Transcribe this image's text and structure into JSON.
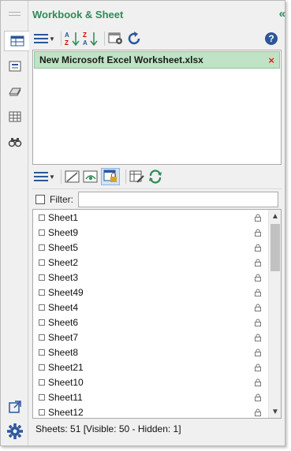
{
  "header": {
    "title": "Workbook & Sheet",
    "collapse_glyph": "«"
  },
  "sidebar": {
    "tabs": [
      {
        "icon": "workbook-sheet-icon",
        "active": true
      },
      {
        "icon": "autotext-icon",
        "active": false
      },
      {
        "icon": "name-manager-icon",
        "active": false
      },
      {
        "icon": "column-list-icon",
        "active": false
      },
      {
        "icon": "find-replace-icon",
        "active": false
      }
    ],
    "bottom": [
      {
        "icon": "undock-icon"
      },
      {
        "icon": "settings-gear-icon"
      }
    ]
  },
  "toolbar1": {
    "items": [
      "list-view-icon",
      "sort-ascending-icon",
      "sort-descending-icon",
      "settings-icon",
      "refresh-icon",
      "help-icon"
    ],
    "help_glyph": "?"
  },
  "workbooks": [
    {
      "name": "New Microsoft Excel Worksheet.xlsx",
      "close_glyph": "×"
    }
  ],
  "toolbar2": {
    "items": [
      "list-view-icon",
      "hide-sheet-icon",
      "show-hidden-icon",
      "protect-sheet-icon",
      "edit-sheet-icon",
      "refresh-icon"
    ]
  },
  "filter": {
    "label": "Filter:",
    "value": "",
    "checked": false
  },
  "sheets": [
    "Sheet1",
    "Sheet9",
    "Sheet5",
    "Sheet2",
    "Sheet3",
    "Sheet49",
    "Sheet4",
    "Sheet6",
    "Sheet7",
    "Sheet8",
    "Sheet21",
    "Sheet10",
    "Sheet11",
    "Sheet12"
  ],
  "status": {
    "text": "Sheets: 51  [Visible: 50 - Hidden: 1]"
  },
  "colors": {
    "accent": "#2e8b57",
    "selected_bg": "#bfe3c4",
    "close": "#e02020",
    "icon_blue": "#2b579a"
  }
}
